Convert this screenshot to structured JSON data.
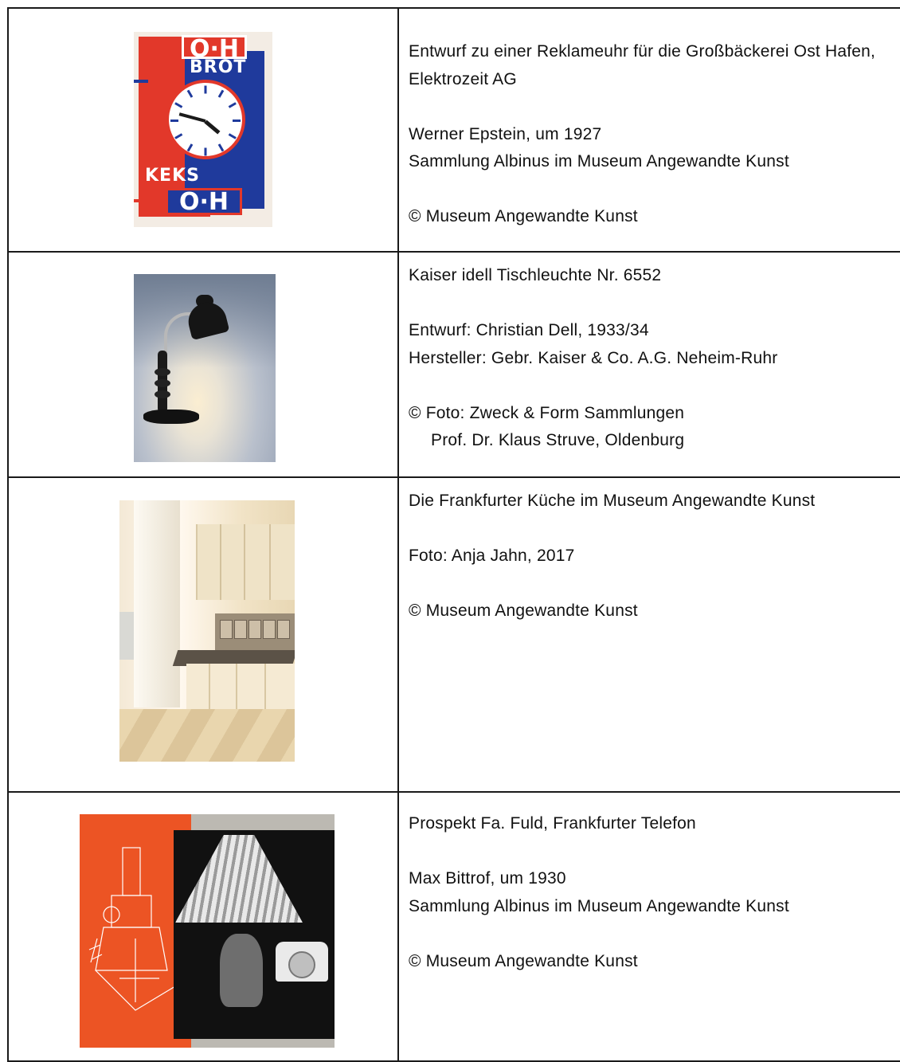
{
  "rows": [
    {
      "title": "Entwurf zu einer Reklameuhr für die Großbäckerei Ost Hafen, Elektrozeit AG",
      "lines": [
        "Werner Epstein, um 1927",
        "Sammlung Albinus im Museum Angewandte Kunst"
      ],
      "credit": [
        "© Museum Angewandte Kunst"
      ],
      "image_text": {
        "top": "O·H",
        "brot": "BROT",
        "keks": "KEKS",
        "bottom": "O·H"
      }
    },
    {
      "title": "Kaiser idell Tischleuchte Nr. 6552",
      "lines": [
        "Entwurf: Christian Dell, 1933/34",
        "Hersteller: Gebr. Kaiser & Co. A.G. Neheim-Ruhr"
      ],
      "credit": [
        "© Foto: Zweck & Form Sammlungen",
        "Prof. Dr. Klaus Struve, Oldenburg"
      ]
    },
    {
      "title": "Die Frankfurter Küche im Museum Angewandte Kunst",
      "lines": [
        "Foto: Anja Jahn, 2017"
      ],
      "credit": [
        "© Museum Angewandte Kunst"
      ]
    },
    {
      "title": "Prospekt Fa. Fuld, Frankfurter Telefon",
      "lines": [
        "Max Bittrof, um 1930",
        "Sammlung Albinus im Museum Angewandte Kunst"
      ],
      "credit": [
        "© Museum Angewandte Kunst"
      ]
    }
  ],
  "colors": {
    "border": "#1a1a1a",
    "poster_red": "#e2382a",
    "poster_blue": "#1f3a9c",
    "fuld_orange": "#ec5424"
  }
}
